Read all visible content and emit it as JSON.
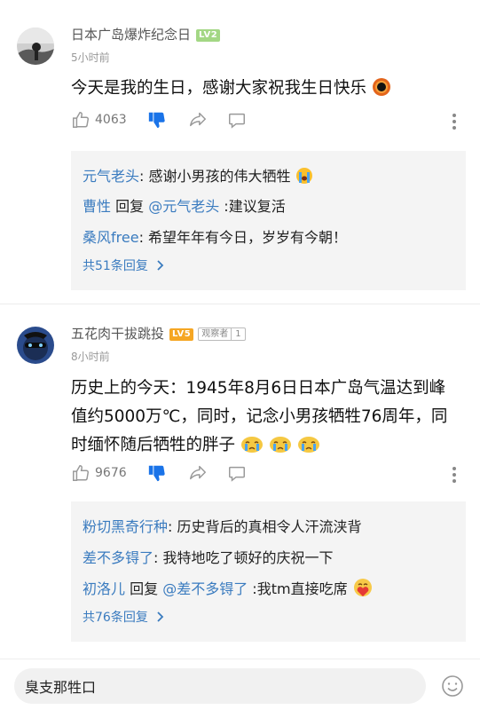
{
  "comments": [
    {
      "username": "日本广岛爆炸纪念日",
      "level": "LV2",
      "time": "5小时前",
      "content": "今天是我的生日，感谢大家祝我生日快乐",
      "content_emoji": "black-hole-emoji",
      "likes": "4063",
      "replies": [
        {
          "user": "元气老头",
          "sep": ":",
          "text": " 感谢小男孩的伟大牺牲",
          "emoji": "crying-emoji"
        },
        {
          "user": "曹性",
          "reply_word": " 回复 ",
          "target": "@元气老头",
          "sep": " :",
          "text": "建议复活"
        },
        {
          "user": "桑风free",
          "sep": ":",
          "text": " 希望年年有今日，岁岁有今朝！"
        }
      ],
      "more_replies": "共51条回复"
    },
    {
      "username": "五花肉干拔跳投",
      "level": "LV5",
      "role_badge": "观察者",
      "role_num": "1",
      "time": "8小时前",
      "content_lines": [
        "历史上的今天：1945年8月6日日本广岛气温达到峰",
        "值约5000万℃，同时，记念小男孩牺牲76周年，同",
        "时缅怀随后牺牲的胖子"
      ],
      "content_emoji": "crying-face-emoji x3",
      "likes": "9676",
      "replies": [
        {
          "user": "粉切黑奇行种",
          "sep": ":",
          "text": " 历史背后的真相令人汗流浃背"
        },
        {
          "user": "差不多锝了",
          "sep": ":",
          "text": " 我特地吃了顿好的庆祝一下"
        },
        {
          "user": "初洛儿",
          "reply_word": " 回复 ",
          "target": "@差不多锝了",
          "sep": " :",
          "text": "我tm直接吃席",
          "emoji": "heart-hug-emoji"
        }
      ],
      "more_replies": "共76条回复"
    }
  ],
  "comment_input": {
    "value": "臭支那牲口"
  },
  "colors": {
    "link": "#3a7bbf",
    "accent_blue": "#1a73e8",
    "reply_bg": "#f4f4f4"
  }
}
